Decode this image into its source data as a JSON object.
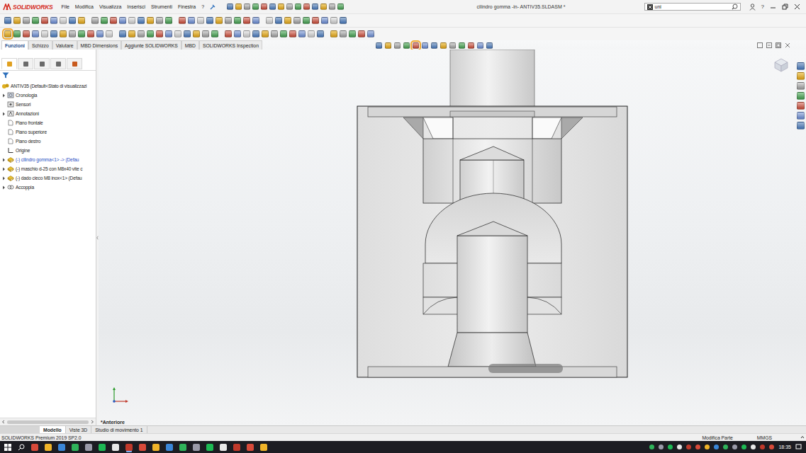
{
  "app": {
    "logo": "SOLIDWORKS",
    "title": "cilindro gomma -in- ANTIV35.SLDASM *"
  },
  "menu": [
    "File",
    "Modifica",
    "Visualizza",
    "Inserisci",
    "Strumenti",
    "Finestra",
    "?"
  ],
  "search": {
    "value": "uni"
  },
  "help_button": "?",
  "toolbar_states": {
    "first_tool_selected": true,
    "display_style_selected": true
  },
  "command_tabs": [
    {
      "label": "Funzioni",
      "selected": true
    },
    {
      "label": "Schizzo",
      "selected": false
    },
    {
      "label": "Valutare",
      "selected": false
    },
    {
      "label": "MBD Dimensions",
      "selected": false
    },
    {
      "label": "Aggiunte SOLIDWORKS",
      "selected": false
    },
    {
      "label": "MBD",
      "selected": false
    },
    {
      "label": "SOLIDWORKS Inspection",
      "selected": false
    }
  ],
  "tree": {
    "root": "ANTIV35  (Default<Stato di visualizzazi",
    "items": [
      {
        "label": "Cronologia",
        "kind": "history",
        "expandable": true,
        "editing": false
      },
      {
        "label": "Sensori",
        "kind": "sensors",
        "expandable": false,
        "editing": false
      },
      {
        "label": "Annotazioni",
        "kind": "annotations",
        "expandable": true,
        "editing": false
      },
      {
        "label": "Piano frontale",
        "kind": "plane",
        "expandable": false,
        "editing": false
      },
      {
        "label": "Piano superiore",
        "kind": "plane",
        "expandable": false,
        "editing": false
      },
      {
        "label": "Piano destro",
        "kind": "plane",
        "expandable": false,
        "editing": false
      },
      {
        "label": "Origine",
        "kind": "origin",
        "expandable": false,
        "editing": false
      },
      {
        "label": "(-) cilindro gomma<1> -> (Defau",
        "kind": "component",
        "expandable": true,
        "editing": true
      },
      {
        "label": "(-) maschio d-25 con M8x40 vite c",
        "kind": "component",
        "expandable": true,
        "editing": false
      },
      {
        "label": "(-) dado cieco M8 inox<1> (Defau",
        "kind": "component",
        "expandable": true,
        "editing": false
      },
      {
        "label": "Accoppia",
        "kind": "mates",
        "expandable": true,
        "editing": false
      }
    ]
  },
  "view": {
    "label": "*Anteriore"
  },
  "bottom_tabs": [
    {
      "label": "Modello",
      "selected": true
    },
    {
      "label": "Viste 3D",
      "selected": false
    },
    {
      "label": "Studio di movimento 1",
      "selected": false
    }
  ],
  "status_bar": {
    "product": "SOLIDWORKS Premium 2019 SP2.0",
    "mode": "Modifica Parte",
    "units": "MMGS"
  },
  "taskbar": {
    "time": "18:35"
  }
}
